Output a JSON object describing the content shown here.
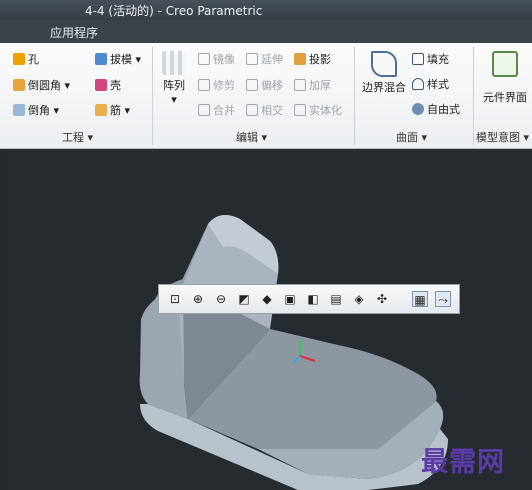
{
  "window": {
    "title": "4-4 (活动的) - Creo Parametric"
  },
  "menu": {
    "applications": "应用程序"
  },
  "ribbon": {
    "engineering": {
      "hole": "孔",
      "draft": "拔模 ▾",
      "round": "倒圆角 ▾",
      "shell": "壳",
      "chamfer": "倒角 ▾",
      "rib": "筋 ▾",
      "group_label": "工程 ▾"
    },
    "editing": {
      "pattern": "阵列",
      "pattern_arrow": "▾",
      "mirror": "镜像",
      "extend": "延伸",
      "project": "投影",
      "trim": "修剪",
      "offset": "偏移",
      "thicken": "加厚",
      "merge": "合并",
      "intersect": "相交",
      "solidify": "实体化",
      "group_label": "编辑 ▾"
    },
    "surfaces": {
      "boundary_blend": "边界混合",
      "fill": "填充",
      "style": "样式",
      "freestyle": "自由式",
      "group_label": "曲面 ▾"
    },
    "model_intent": {
      "component_interface": "元件界面",
      "group_label": "模型意图 ▾"
    }
  },
  "view_toolbar": {
    "icons": [
      "zoom-fit-icon",
      "zoom-in-icon",
      "zoom-out-icon",
      "repaint-icon",
      "display-style-icon",
      "saved-views-icon",
      "named-views-icon",
      "view-manager-icon",
      "perspective-icon",
      "datum-display-icon",
      "spin-center-icon",
      "annotation-display-icon"
    ]
  },
  "watermark": "最需网",
  "colors": {
    "accent": "#f0a000",
    "viewport_bg": "#262b2f",
    "model_face": "#9aa6b1"
  }
}
